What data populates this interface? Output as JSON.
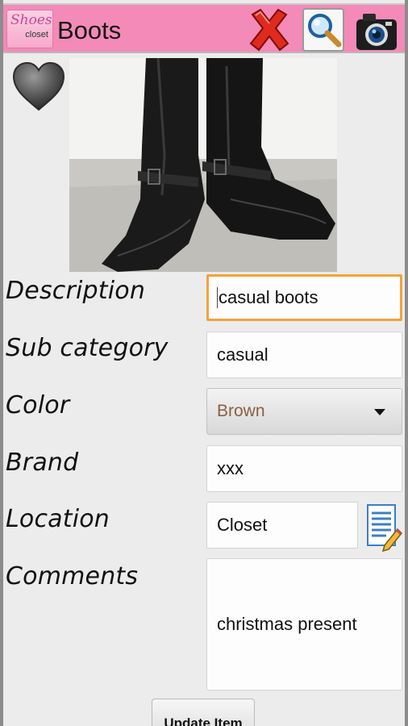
{
  "app": {
    "logo_text_top": "Shoes",
    "logo_text_bottom": "closet",
    "title": "Boots"
  },
  "icons": {
    "close": "close-icon",
    "search": "search-icon",
    "camera": "camera-icon",
    "favorite": "heart-icon",
    "edit": "edit-notes-icon"
  },
  "colors": {
    "titlebar": "#f48ab8",
    "focus_border": "#f4a23a",
    "select_text": "#8a6043"
  },
  "form": {
    "description": {
      "label": "Description",
      "value": "casual boots"
    },
    "sub_category": {
      "label": "Sub category",
      "value": "casual"
    },
    "color": {
      "label": "Color",
      "selected": "Brown"
    },
    "brand": {
      "label": "Brand",
      "value": "xxx"
    },
    "location": {
      "label": "Location",
      "value": "Closet"
    },
    "comments": {
      "label": "Comments",
      "value": "christmas present"
    },
    "update_label": "Update Item"
  }
}
